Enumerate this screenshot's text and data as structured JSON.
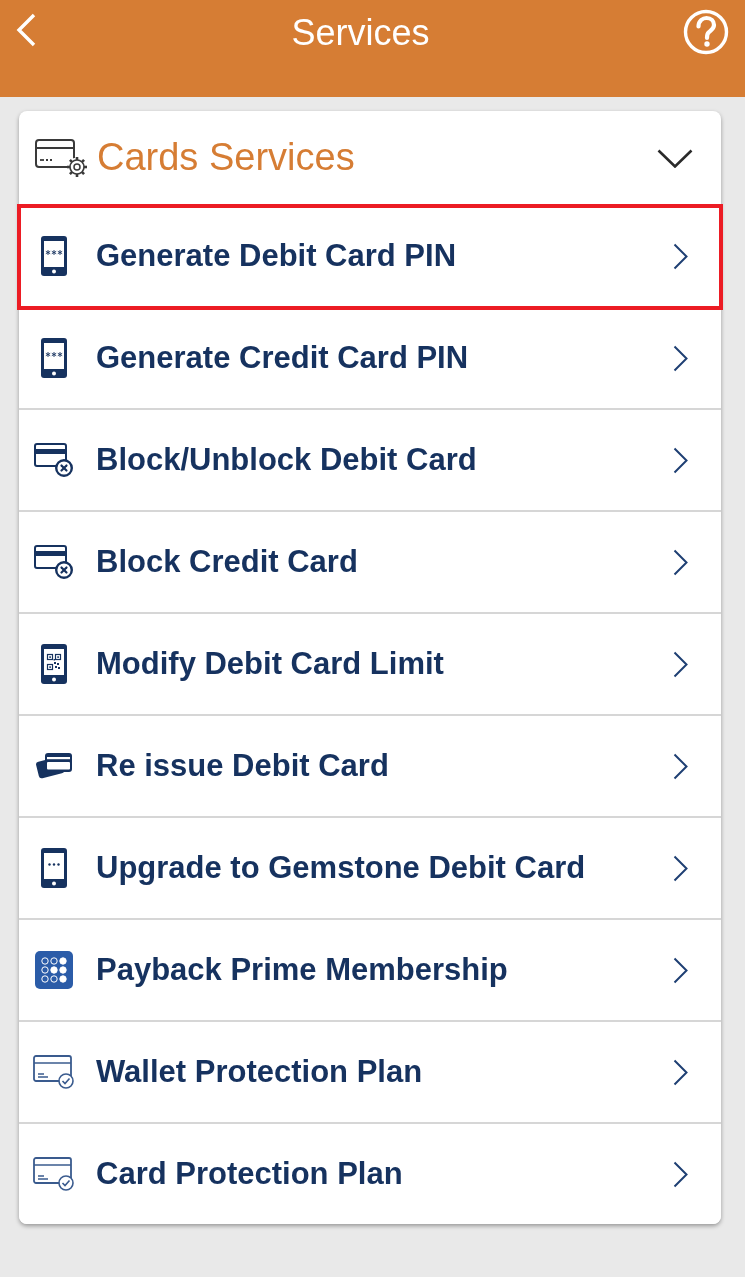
{
  "header": {
    "title": "Services"
  },
  "section": {
    "title": "Cards Services",
    "expanded": true,
    "items": [
      {
        "label": "Generate Debit Card PIN",
        "highlighted": true
      },
      {
        "label": "Generate Credit Card PIN",
        "highlighted": false
      },
      {
        "label": "Block/Unblock Debit Card",
        "highlighted": false
      },
      {
        "label": "Block Credit Card",
        "highlighted": false
      },
      {
        "label": "Modify Debit Card Limit",
        "highlighted": false
      },
      {
        "label": "Re issue Debit Card",
        "highlighted": false
      },
      {
        "label": "Upgrade to Gemstone Debit Card",
        "highlighted": false
      },
      {
        "label": "Payback Prime Membership",
        "highlighted": false
      },
      {
        "label": "Wallet Protection Plan",
        "highlighted": false
      },
      {
        "label": "Card Protection Plan",
        "highlighted": false
      }
    ]
  }
}
